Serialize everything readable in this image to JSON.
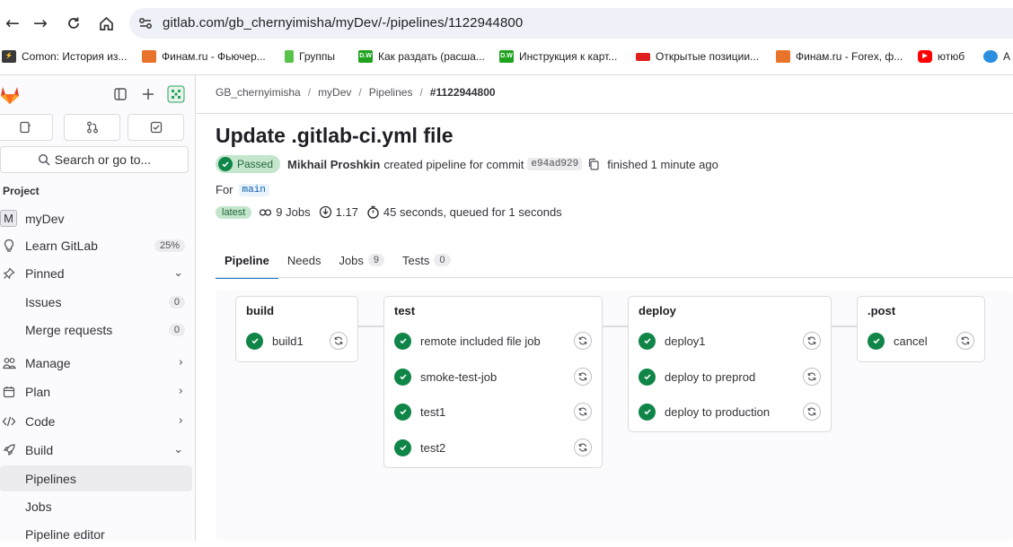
{
  "browser": {
    "url": "gitlab.com/gb_chernyimisha/myDev/-/pipelines/1122944800",
    "bookmarks": [
      {
        "label": "Comon: История из...",
        "color": "#3a3a3a"
      },
      {
        "label": "Финам.ru - Фьючер...",
        "color": "#e8732b"
      },
      {
        "label": "Группы",
        "color": "#58c34a"
      },
      {
        "label": "Как раздать (расша...",
        "color": "#1fa31f"
      },
      {
        "label": "Инструкция к карт...",
        "color": "#1fa31f"
      },
      {
        "label": "Открытые позиции...",
        "color": "#e0201e"
      },
      {
        "label": "Финам.ru - Forex, ф...",
        "color": "#e8732b"
      },
      {
        "label": "ютюб",
        "color": "#ff0000"
      },
      {
        "label": "A",
        "color": "#2b8fe0"
      }
    ]
  },
  "sidebar": {
    "search_label": "Search or go to...",
    "section_label": "Project",
    "project": {
      "avatar": "M",
      "name": "myDev"
    },
    "learn": {
      "label": "Learn GitLab",
      "count": "25%"
    },
    "pinned": {
      "label": "Pinned"
    },
    "issues": {
      "label": "Issues",
      "count": "0"
    },
    "merge_requests": {
      "label": "Merge requests",
      "count": "0"
    },
    "manage": {
      "label": "Manage"
    },
    "plan": {
      "label": "Plan"
    },
    "code": {
      "label": "Code"
    },
    "build": {
      "label": "Build"
    },
    "pipelines": {
      "label": "Pipelines"
    },
    "jobs": {
      "label": "Jobs"
    },
    "pipeline_editor": {
      "label": "Pipeline editor"
    }
  },
  "breadcrumb": {
    "group": "GB_chernyimisha",
    "project": "myDev",
    "section": "Pipelines",
    "current": "#1122944800"
  },
  "pipeline": {
    "title": "Update .gitlab-ci.yml file",
    "status": "Passed",
    "author": "Mikhail Proshkin",
    "created_text": "created pipeline for commit",
    "sha": "e94ad929",
    "finished": "finished 1 minute ago",
    "for_label": "For",
    "branch": "main",
    "latest": "latest",
    "jobs_count": "9 Jobs",
    "version": "1.17",
    "duration": "45 seconds, queued for 1 seconds"
  },
  "tabs": {
    "pipeline": "Pipeline",
    "needs": "Needs",
    "jobs": "Jobs",
    "jobs_count": "9",
    "tests": "Tests",
    "tests_count": "0"
  },
  "stages": [
    {
      "name": "build",
      "jobs": [
        "build1"
      ]
    },
    {
      "name": "test",
      "jobs": [
        "remote included file job",
        "smoke-test-job",
        "test1",
        "test2"
      ]
    },
    {
      "name": "deploy",
      "jobs": [
        "deploy1",
        "deploy to preprod",
        "deploy to production"
      ]
    },
    {
      "name": ".post",
      "jobs": [
        "cancel"
      ]
    }
  ],
  "colors": {
    "success": "#108548",
    "accent": "#1f75cb"
  }
}
